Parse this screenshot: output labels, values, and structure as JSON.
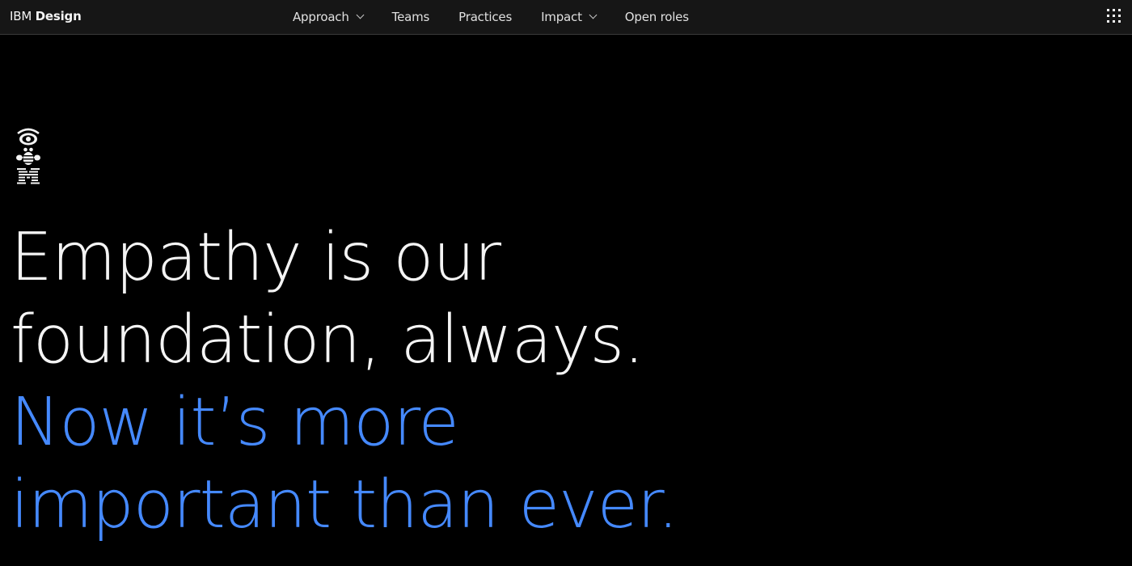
{
  "header": {
    "brand": {
      "prefix": "IBM",
      "name": "Design"
    },
    "nav": [
      {
        "label": "Approach",
        "has_dropdown": true
      },
      {
        "label": "Teams",
        "has_dropdown": false
      },
      {
        "label": "Practices",
        "has_dropdown": false
      },
      {
        "label": "Impact",
        "has_dropdown": true
      },
      {
        "label": "Open roles",
        "has_dropdown": false
      }
    ],
    "switcher_icon": "app-switcher-grid-icon"
  },
  "hero": {
    "logo_icon": "eye-bee-m-rebus-icon",
    "headline": {
      "lines_primary": [
        "Empathy is our",
        "foundation, always."
      ],
      "lines_accent": [
        "Now it’s more",
        "important than ever."
      ]
    }
  },
  "colors": {
    "background": "#000000",
    "header_bg": "#161616",
    "header_border": "#393939",
    "text_primary": "#f4f4f4",
    "accent_blue": "#4589ff"
  }
}
